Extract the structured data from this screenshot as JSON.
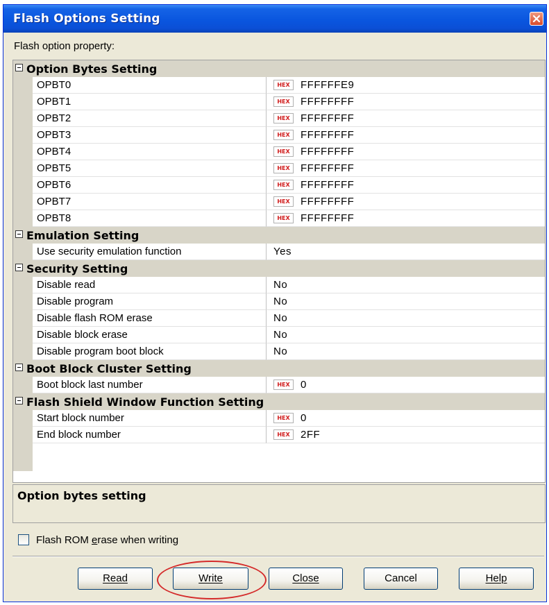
{
  "window": {
    "title": "Flash Options Setting"
  },
  "property_label": "Flash option property:",
  "sections": [
    {
      "title": "Option Bytes Setting",
      "items": [
        {
          "name": "OPBT0",
          "hex": true,
          "value": "FFFFFFE9"
        },
        {
          "name": "OPBT1",
          "hex": true,
          "value": "FFFFFFFF"
        },
        {
          "name": "OPBT2",
          "hex": true,
          "value": "FFFFFFFF"
        },
        {
          "name": "OPBT3",
          "hex": true,
          "value": "FFFFFFFF"
        },
        {
          "name": "OPBT4",
          "hex": true,
          "value": "FFFFFFFF"
        },
        {
          "name": "OPBT5",
          "hex": true,
          "value": "FFFFFFFF"
        },
        {
          "name": "OPBT6",
          "hex": true,
          "value": "FFFFFFFF"
        },
        {
          "name": "OPBT7",
          "hex": true,
          "value": "FFFFFFFF"
        },
        {
          "name": "OPBT8",
          "hex": true,
          "value": "FFFFFFFF"
        }
      ]
    },
    {
      "title": "Emulation Setting",
      "items": [
        {
          "name": "Use security emulation function",
          "hex": false,
          "value": "Yes"
        }
      ]
    },
    {
      "title": "Security Setting",
      "items": [
        {
          "name": "Disable read",
          "hex": false,
          "value": "No"
        },
        {
          "name": "Disable program",
          "hex": false,
          "value": "No"
        },
        {
          "name": "Disable flash ROM erase",
          "hex": false,
          "value": "No"
        },
        {
          "name": "Disable block erase",
          "hex": false,
          "value": "No"
        },
        {
          "name": "Disable program boot block",
          "hex": false,
          "value": "No"
        }
      ]
    },
    {
      "title": "Boot Block Cluster Setting",
      "items": [
        {
          "name": "Boot block last number",
          "hex": true,
          "value": "0"
        }
      ]
    },
    {
      "title": "Flash Shield Window Function Setting",
      "items": [
        {
          "name": "Start block number",
          "hex": true,
          "value": "0"
        },
        {
          "name": "End block number",
          "hex": true,
          "value": "2FF"
        }
      ]
    }
  ],
  "hex_badge": "HEX",
  "description_title": "Option bytes setting",
  "erase_checkbox": {
    "label": "Flash ROM erase when writing",
    "checked": false
  },
  "buttons": {
    "read": "Read",
    "write": "Write",
    "close": "Close",
    "cancel": "Cancel",
    "help": "Help"
  },
  "colors": {
    "title_bar": "#0a56df",
    "highlight_ring": "#d42a2a",
    "hex_badge": "#d01a1a"
  }
}
